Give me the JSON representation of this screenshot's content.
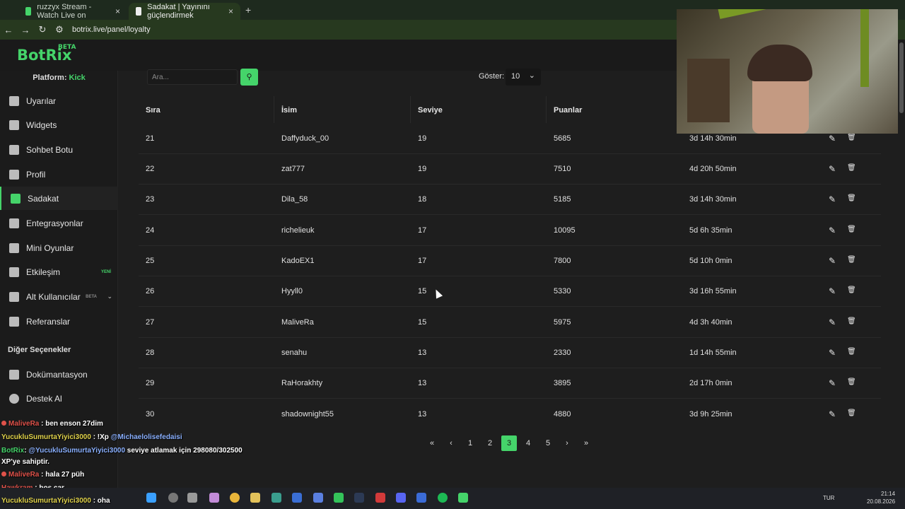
{
  "browser": {
    "tabs": [
      {
        "label": "ruzzyx Stream - Watch Live on"
      },
      {
        "label": "Sadakat | Yayınını güçlendirmek"
      }
    ],
    "url": "botrix.live/panel/loyalty"
  },
  "logo": {
    "name": "BotRix",
    "beta": "BETA"
  },
  "sidebar": {
    "platform_label": "Platform:",
    "platform_value": "Kick",
    "items": [
      {
        "label": "Uyarılar",
        "icon": "warning-icon"
      },
      {
        "label": "Widgets",
        "icon": "grid-icon"
      },
      {
        "label": "Sohbet Botu",
        "icon": "robot-icon"
      },
      {
        "label": "Profil",
        "icon": "id-card-icon"
      },
      {
        "label": "Sadakat",
        "icon": "trophy-icon"
      },
      {
        "label": "Entegrasyonlar",
        "icon": "plug-icon"
      },
      {
        "label": "Mini Oyunlar",
        "icon": "gamepad-icon"
      },
      {
        "label": "Etkileşim",
        "icon": "music-icon",
        "badge": "YENİ"
      },
      {
        "label": "Alt Kullanıcılar",
        "icon": "users-icon",
        "badge": "BETA"
      },
      {
        "label": "Referanslar",
        "icon": "people-icon"
      }
    ],
    "other_title": "Diğer Seçenekler",
    "other_items": [
      {
        "label": "Dokümantasyon",
        "icon": "doc-icon"
      },
      {
        "label": "Destek Al",
        "icon": "help-icon"
      }
    ]
  },
  "toolbar": {
    "search_placeholder": "Ara...",
    "show_label": "Göster:",
    "show_value": "10"
  },
  "table": {
    "headers": [
      "Sıra",
      "İsim",
      "Seviye",
      "Puanlar"
    ],
    "rows": [
      {
        "rank": "21",
        "name": "Daffyduck_00",
        "level": "19",
        "points": "5685",
        "time": "3d 14h 30min"
      },
      {
        "rank": "22",
        "name": "zat777",
        "level": "19",
        "points": "7510",
        "time": "4d 20h 50min"
      },
      {
        "rank": "23",
        "name": "Dila_58",
        "level": "18",
        "points": "5185",
        "time": "3d 14h 30min"
      },
      {
        "rank": "24",
        "name": "richelieuk",
        "level": "17",
        "points": "10095",
        "time": "5d 6h 35min"
      },
      {
        "rank": "25",
        "name": "KadoEX1",
        "level": "17",
        "points": "7800",
        "time": "5d 10h 0min"
      },
      {
        "rank": "26",
        "name": "Hyyll0",
        "level": "15",
        "points": "5330",
        "time": "3d 16h 55min"
      },
      {
        "rank": "27",
        "name": "MaliveRa",
        "level": "15",
        "points": "5975",
        "time": "4d 3h 40min"
      },
      {
        "rank": "28",
        "name": "senahu",
        "level": "13",
        "points": "2330",
        "time": "1d 14h 55min"
      },
      {
        "rank": "29",
        "name": "RaHorakhty",
        "level": "13",
        "points": "3895",
        "time": "2d 17h 0min"
      },
      {
        "rank": "30",
        "name": "shadownight55",
        "level": "13",
        "points": "4880",
        "time": "3d 9h 25min"
      }
    ]
  },
  "pagination": {
    "pages": [
      "1",
      "2",
      "3",
      "4",
      "5"
    ],
    "current": "3",
    "first": "«",
    "prev": "‹",
    "next": "›",
    "last": "»"
  },
  "chat": {
    "lines": [
      {
        "user": "MaliveRa",
        "text": ": ben enson 27dim"
      },
      {
        "user": "YucukluSumurtaYiyici3000",
        "text": ": !Xp",
        "mention": "@Michaelolisefedaisi"
      },
      {
        "user": "BotRix",
        "text": ": ",
        "mention": "@YucukluSumurtaYiyici3000",
        "text2": " seviye atlamak için 298080/302500"
      },
      {
        "user": "",
        "text": "XP'ye sahiptir."
      },
      {
        "user": "MaliveRa",
        "text": ": hala 27 püh"
      },
      {
        "user": "Hawkram",
        "text": ": boş çar"
      },
      {
        "user": "YucukluSumurtaYiyici3000",
        "text": ": oha"
      }
    ]
  },
  "system": {
    "lang": "TUR",
    "time": "21:14",
    "date": "20.08.2026"
  }
}
